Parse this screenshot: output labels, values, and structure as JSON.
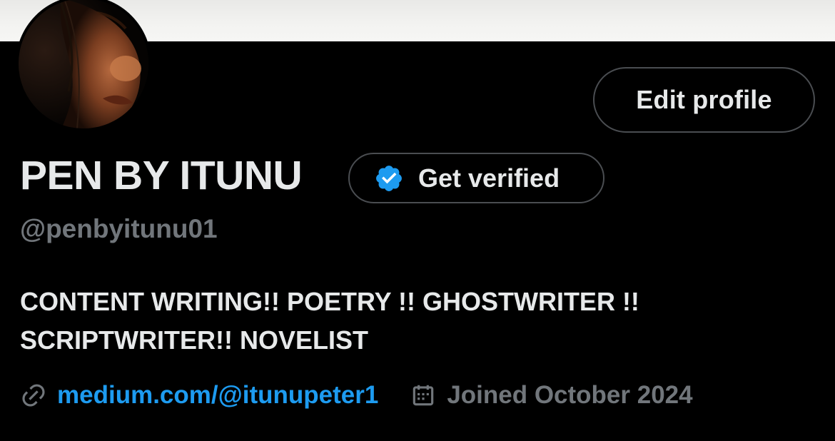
{
  "colors": {
    "background": "#000000",
    "text_primary": "#e7e9ea",
    "text_secondary": "#71767b",
    "link": "#1d9bf0",
    "verified_badge": "#1d9bf0",
    "button_border": "#4a4d51"
  },
  "header": {
    "banner_image": "profile-banner",
    "avatar_image": "profile-avatar"
  },
  "profile": {
    "edit_button_label": "Edit profile",
    "display_name": "PEN BY ITUNU",
    "get_verified_label": "Get verified",
    "get_verified_icon": "verified-badge-icon",
    "handle": "@penbyitunu01",
    "bio": "CONTENT WRITING!! POETRY !! GHOSTWRITER !!\nSCRIPTWRITER!! NOVELIST",
    "website": {
      "icon": "link-icon",
      "text": "medium.com/@itunupeter1"
    },
    "joined": {
      "icon": "calendar-icon",
      "text": "Joined October 2024"
    }
  }
}
